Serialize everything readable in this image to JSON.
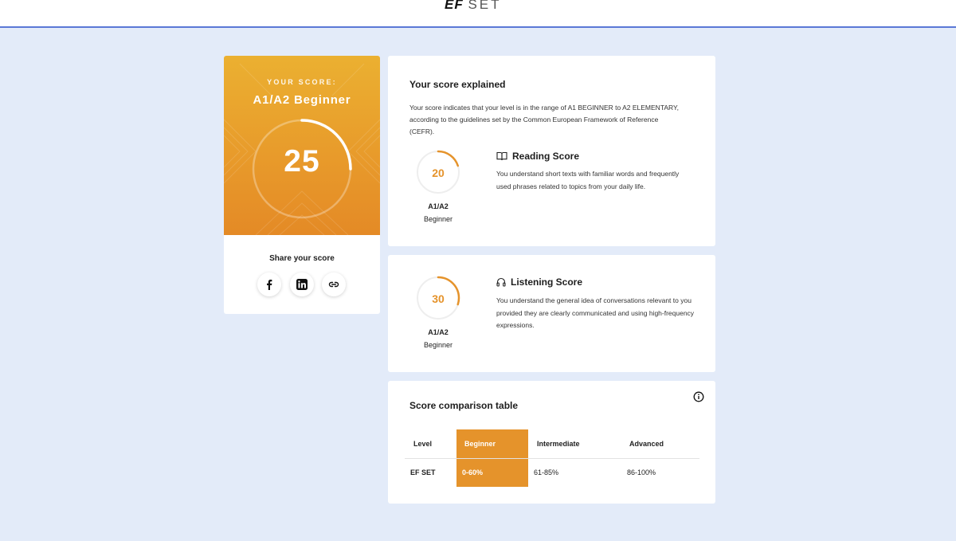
{
  "header": {
    "logo_ef": "EF",
    "logo_set": "SET"
  },
  "score_card": {
    "label": "YOUR SCORE:",
    "level": "A1/A2 Beginner",
    "score": "25",
    "score_progress": 0.25,
    "share_label": "Share your score",
    "share_buttons": [
      "facebook-icon",
      "linkedin-icon",
      "link-icon"
    ]
  },
  "explained": {
    "title": "Your score explained",
    "text": "Your score indicates that your level is in the range of A1 BEGINNER to A2 ELEMENTARY, according to the guidelines set by the Common European Framework of Reference (CEFR)."
  },
  "reading": {
    "score": "20",
    "progress": 0.2,
    "level": "A1/A2",
    "level_sub": "Beginner",
    "icon": "book-icon",
    "title": "Reading Score",
    "description": "You understand short texts with familiar words and frequently used phrases related to topics from your daily life."
  },
  "listening": {
    "score": "30",
    "progress": 0.3,
    "level": "A1/A2",
    "level_sub": "Beginner",
    "icon": "headphones-icon",
    "title": "Listening Score",
    "description": "You understand the general idea of conversations relevant to you provided they are clearly communicated and using high-frequency expressions."
  },
  "comparison": {
    "title": "Score comparison table",
    "headers": [
      "Level",
      "Beginner",
      "Intermediate",
      "Advanced"
    ],
    "row": [
      "EF SET",
      "0-60%",
      "61-85%",
      "86-100%"
    ],
    "highlight_color": "#e5932b"
  },
  "colors": {
    "accent": "#e5932b",
    "background": "#e3ebf9",
    "header_line": "#5b78d6"
  }
}
